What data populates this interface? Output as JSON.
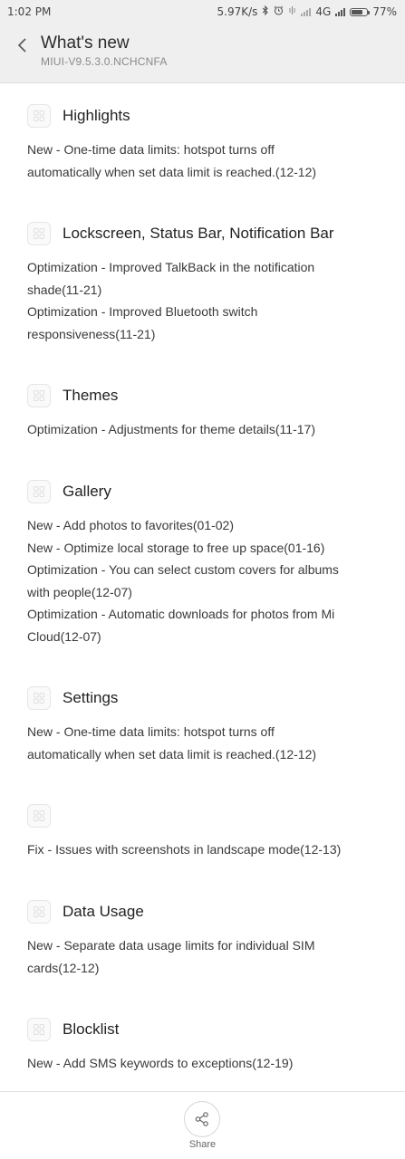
{
  "status_bar": {
    "time": "1:02 PM",
    "network_speed": "5.97K/s",
    "network_type": "4G",
    "battery": "77%",
    "battery_level": 0.77,
    "icons": [
      "bluetooth-icon",
      "alarm-icon",
      "vibrate-icon",
      "signal-icon",
      "signal-icon",
      "battery-icon"
    ]
  },
  "header": {
    "title": "What's new",
    "subtitle": "MIUI-V9.5.3.0.NCHCNFA",
    "back_icon": "chevron-left-icon"
  },
  "sections": [
    {
      "title": "Highlights",
      "lines": [
        "New - One-time data limits: hotspot turns off",
        "automatically when set data limit is reached.(12-12)"
      ]
    },
    {
      "title": "Lockscreen, Status Bar, Notification Bar",
      "lines": [
        "Optimization - Improved TalkBack in the notification",
        "shade(11-21)",
        "Optimization - Improved Bluetooth switch",
        "responsiveness(11-21)"
      ]
    },
    {
      "title": "Themes",
      "lines": [
        "Optimization - Adjustments for theme details(11-17)"
      ]
    },
    {
      "title": "Gallery",
      "lines": [
        "New - Add photos to favorites(01-02)",
        "New - Optimize local storage to free up space(01-16)",
        "Optimization - You can select custom covers for albums",
        "with people(12-07)",
        "Optimization - Automatic downloads for photos from Mi",
        "Cloud(12-07)"
      ]
    },
    {
      "title": "Settings",
      "lines": [
        "New - One-time data limits: hotspot turns off",
        "automatically when set data limit is reached.(12-12)"
      ]
    },
    {
      "title": "",
      "lines": [
        "Fix - Issues with screenshots in landscape mode(12-13)"
      ]
    },
    {
      "title": "Data Usage",
      "lines": [
        "New - Separate data usage limits for individual SIM",
        "cards(12-12)"
      ]
    },
    {
      "title": "Blocklist",
      "lines": [
        "New - Add SMS keywords to exceptions(12-19)"
      ]
    }
  ],
  "bottom_bar": {
    "share_label": "Share",
    "share_icon": "share-icon"
  }
}
